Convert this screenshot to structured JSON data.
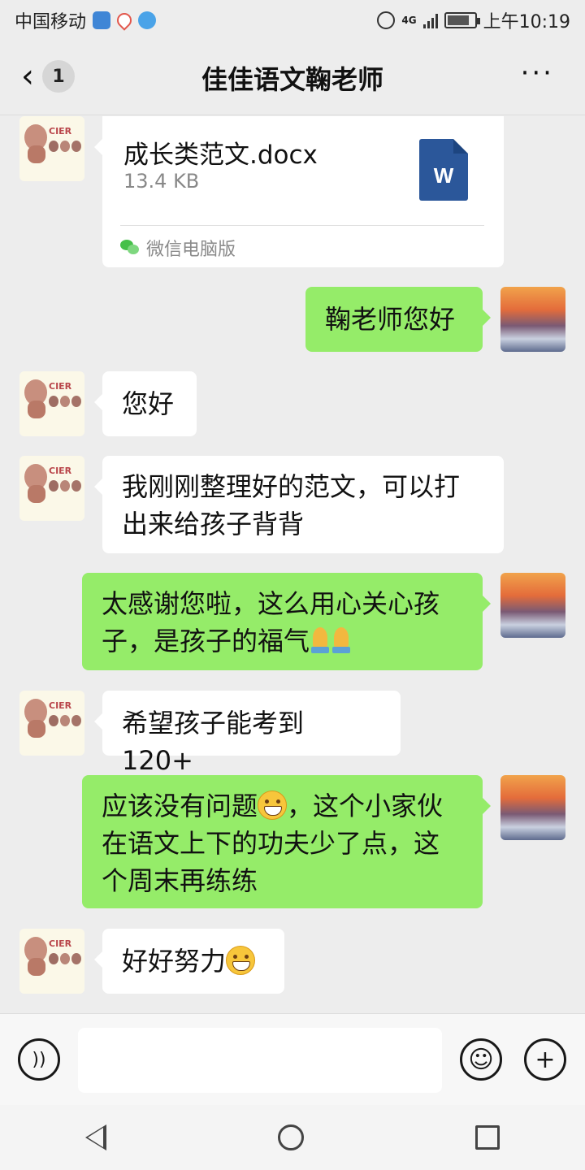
{
  "status_bar": {
    "carrier": "中国移动",
    "network": "4G",
    "time": "上午10:19"
  },
  "header": {
    "title": "佳佳语文鞠老师",
    "unread_count": "1",
    "more_label": "···"
  },
  "file_message": {
    "file_name": "成长类范文.docx",
    "file_size": "13.4 KB",
    "file_icon_letter": "W",
    "source": "微信电脑版"
  },
  "messages": [
    {
      "sender": "self",
      "text": "鞠老师您好"
    },
    {
      "sender": "teacher",
      "text": "您好"
    },
    {
      "sender": "teacher",
      "lines": [
        "我刚刚整理好的范文，可以打",
        "出来给孩子背背"
      ]
    },
    {
      "sender": "self",
      "lines": [
        "太感谢您啦，这么用心关心孩",
        "子，是孩子的福气"
      ]
    },
    {
      "sender": "teacher",
      "text": "希望孩子能考到 120+"
    },
    {
      "sender": "self",
      "lines": [
        "应该没有问题",
        "，这个小家伙",
        "在语文上下的功夫少了点，这",
        "个周末再练练"
      ]
    },
    {
      "sender": "teacher",
      "text": "好好努力"
    }
  ],
  "input_bar": {
    "input_value": ""
  },
  "avatar_teacher_text": "CIER"
}
